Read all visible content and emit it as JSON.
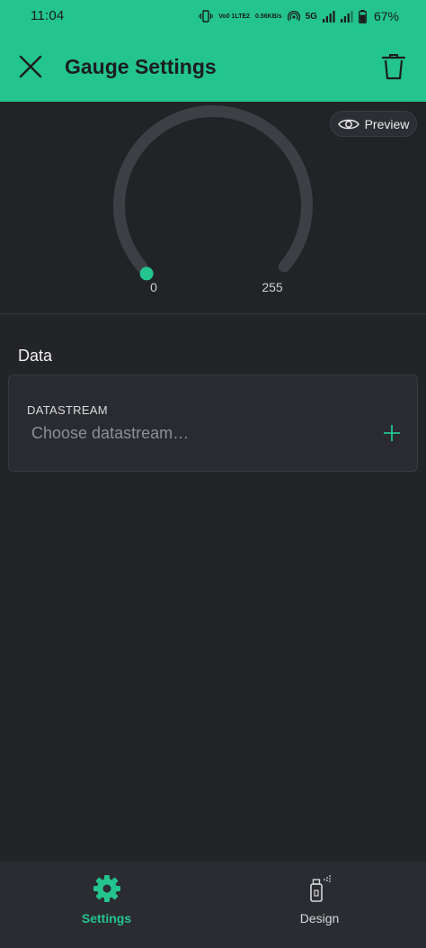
{
  "status_bar": {
    "time": "11:04",
    "volte_line1": "Vo0 1",
    "volte_line2": "LTE2",
    "speed_line1": "0.56",
    "speed_line2": "KB/s",
    "network": "5G",
    "battery_pct": "67%"
  },
  "app_bar": {
    "title": "Gauge Settings",
    "close_icon": "close-icon",
    "delete_icon": "trash-icon"
  },
  "preview": {
    "button_label": "Preview",
    "gauge": {
      "min": "0",
      "max": "255",
      "value_fraction": 0,
      "accent": "#23c48e",
      "track": "#3e3f44"
    }
  },
  "data_section": {
    "title": "Data",
    "datastream": {
      "label": "DATASTREAM",
      "placeholder": "Choose datastream…"
    }
  },
  "bottom_nav": {
    "items": [
      {
        "label": "Settings",
        "icon": "gear-icon",
        "active": true
      },
      {
        "label": "Design",
        "icon": "spray-can-icon",
        "active": false
      }
    ]
  },
  "colors": {
    "brand": "#23c48e",
    "background": "#232428",
    "card": "#2a2b30"
  }
}
